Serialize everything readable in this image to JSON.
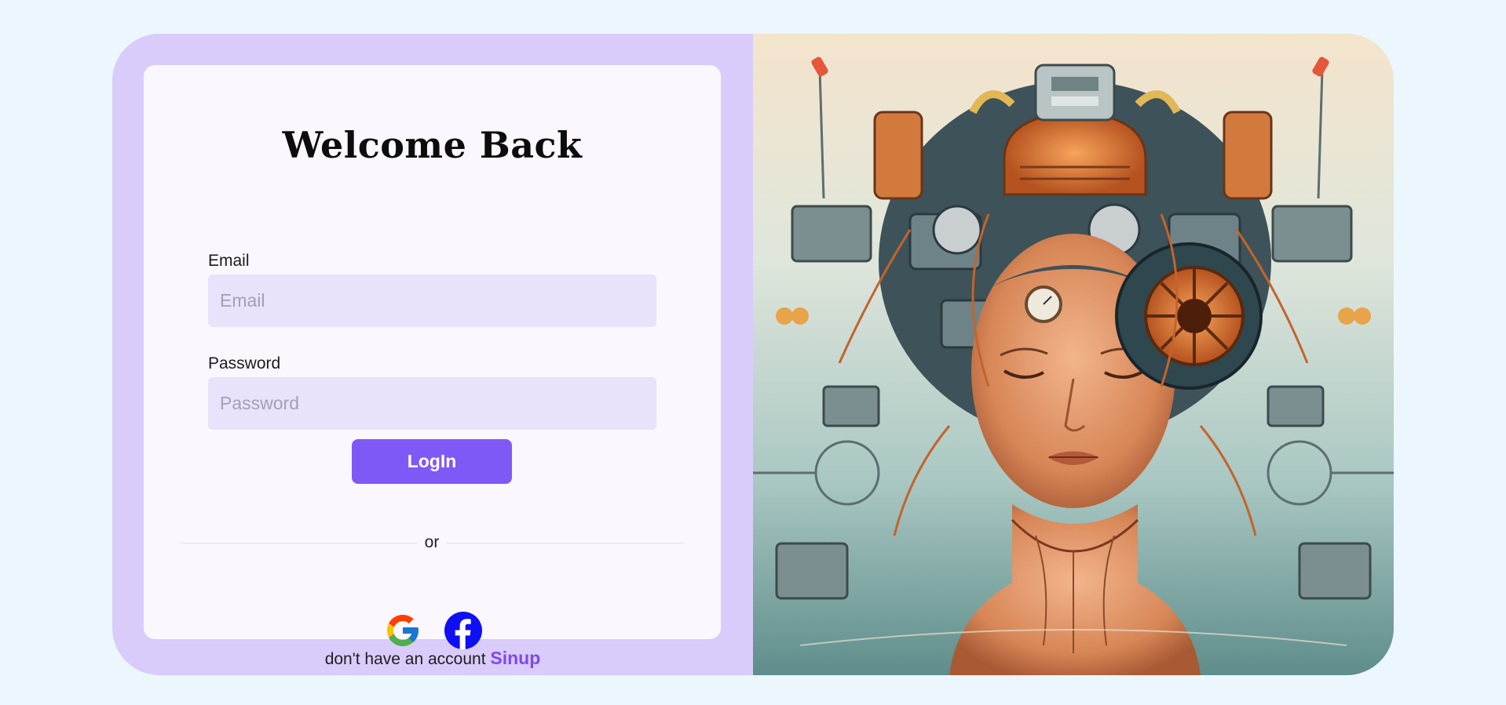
{
  "login": {
    "title": "Welcome Back",
    "email_label": "Email",
    "email_placeholder": "Email",
    "email_value": "",
    "password_label": "Password",
    "password_placeholder": "Password",
    "password_value": "",
    "login_button": "LogIn",
    "divider_text": "or",
    "social_buttons": [
      {
        "icon": "google-icon"
      },
      {
        "icon": "facebook-icon"
      }
    ],
    "footer_text": "don't have an account",
    "signup_link": "Sinup"
  },
  "colors": {
    "page_bg": "#ecf7fd",
    "card_left_bg": "#d9ccfa",
    "panel_bg": "#faf7fe",
    "input_bg": "#e9e2fb",
    "accent": "#7f59f5",
    "link": "#7f49ea",
    "facebook_blue": "#0f0ff5"
  },
  "illustration": {
    "icon": "robot-head-artwork"
  }
}
